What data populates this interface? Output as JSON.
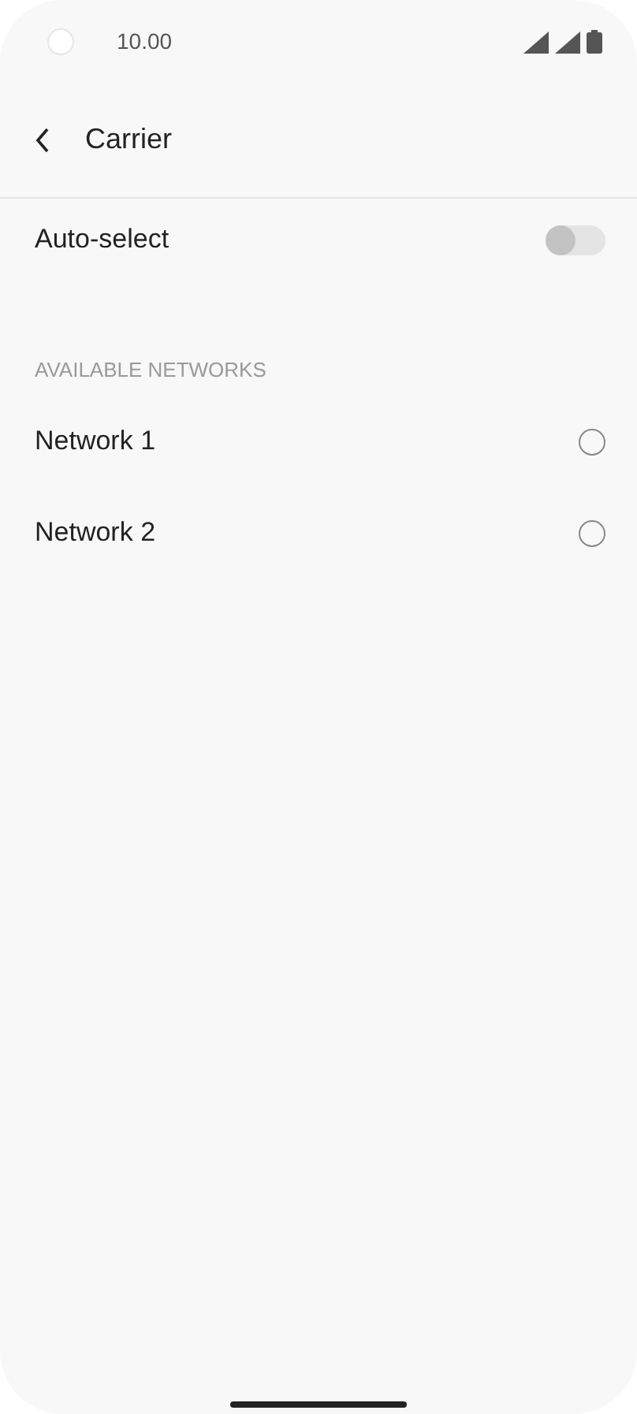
{
  "status_bar": {
    "time": "10.00"
  },
  "header": {
    "title": "Carrier"
  },
  "auto_select": {
    "label": "Auto-select",
    "on": false
  },
  "section": {
    "title": "AVAILABLE NETWORKS"
  },
  "networks": [
    {
      "name": "Network 1",
      "selected": false
    },
    {
      "name": "Network 2",
      "selected": false
    }
  ]
}
